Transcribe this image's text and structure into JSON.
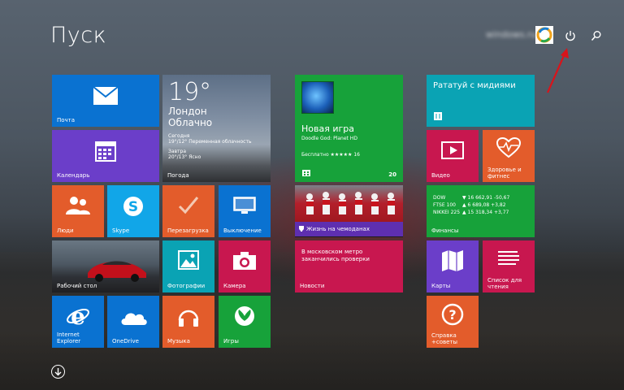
{
  "header": {
    "title": "Пуск",
    "user_name": "windows.ru"
  },
  "tiles": {
    "mail": "Почта",
    "calendar": "Календарь",
    "weather": {
      "temp": "19°",
      "city": "Лондон",
      "condition": "Облачно",
      "today_label": "Сегодня",
      "today_detail": "19°/12° Переменная облачность",
      "tomorrow_label": "Завтра",
      "tomorrow_detail": "20°/13° Ясно",
      "label": "Погода"
    },
    "people": "Люди",
    "skype": "Skype",
    "restart": "Перезагрузка",
    "shutdown": "Выключение",
    "desktop": "Рабочий стол",
    "photos": "Фотографии",
    "camera": "Камера",
    "ie": "Internet Explorer",
    "onedrive": "OneDrive",
    "music": "Музыка",
    "games": "Игры",
    "store": {
      "title": "Новая игра",
      "subtitle": "Doodle God: Planet HD",
      "free": "Бесплатно ★★★★★ 16",
      "count": "20"
    },
    "news_photo": {
      "caption": "Жизнь на чемоданах"
    },
    "news": {
      "headline": "В московском метро заканчились проверки",
      "label": "Новости"
    },
    "food": {
      "title": "Рататуй с мидиями"
    },
    "video": "Видео",
    "health": "Здоровье и фитнес",
    "finance": {
      "label": "Финансы",
      "rows": [
        {
          "name": "DOW",
          "value": "▼ 16 662,91 -50,67"
        },
        {
          "name": "FTSE 100",
          "value": "▲ 6 689,08 +3,82"
        },
        {
          "name": "NIKKEI 225",
          "value": "▲ 15 318,34 +3,77"
        }
      ]
    },
    "maps": "Карты",
    "reading": "Список для чтения",
    "help": "Справка +советы"
  },
  "colors": {
    "blue": "#0a72d1",
    "purple": "#6b3ec9",
    "orange": "#e35c2b",
    "green": "#17a23a",
    "crimson": "#c8174f",
    "teal": "#0aa3b4",
    "skype": "#11a6e8"
  }
}
